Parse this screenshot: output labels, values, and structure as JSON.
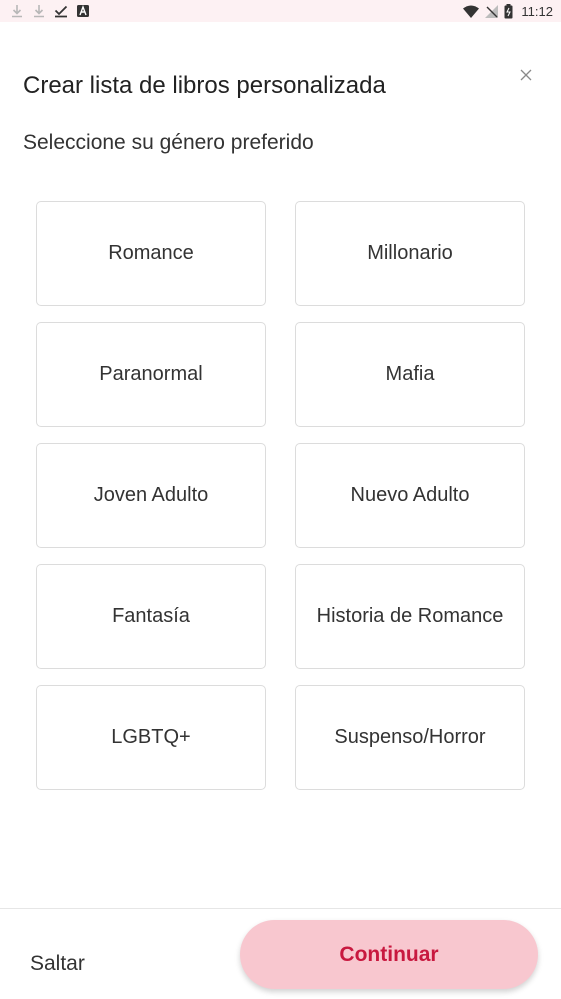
{
  "status_bar": {
    "left_icons": [
      "download-icon",
      "download-icon",
      "check-icon",
      "app-a-icon"
    ],
    "time": "11:12"
  },
  "header": {
    "title": "Crear lista de libros personalizada",
    "subtitle": "Seleccione su género preferido"
  },
  "genres": [
    {
      "label": "Romance"
    },
    {
      "label": "Millonario"
    },
    {
      "label": "Paranormal"
    },
    {
      "label": "Mafia"
    },
    {
      "label": "Joven Adulto"
    },
    {
      "label": "Nuevo Adulto"
    },
    {
      "label": "Fantasía"
    },
    {
      "label": "Historia de Romance"
    },
    {
      "label": "LGBTQ+"
    },
    {
      "label": "Suspenso/Horror"
    }
  ],
  "footer": {
    "skip_label": "Saltar",
    "continue_label": "Continuar"
  },
  "colors": {
    "accent": "#c8183f",
    "button_bg": "#f8c7cf",
    "status_bar_bg": "#fdf1f3"
  }
}
